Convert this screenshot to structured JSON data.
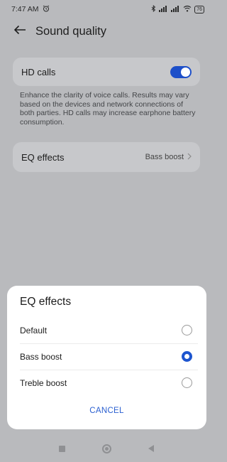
{
  "status_bar": {
    "time": "7:47 AM",
    "battery": "76"
  },
  "header": {
    "title": "Sound quality"
  },
  "hd_calls": {
    "label": "HD calls",
    "enabled": true,
    "description": "Enhance the clarity of voice calls. Results may vary based on the devices and network connections of both parties. HD calls may increase earphone battery consumption."
  },
  "eq_row": {
    "label": "EQ effects",
    "value": "Bass boost"
  },
  "dialog": {
    "title": "EQ effects",
    "options": [
      {
        "label": "Default",
        "selected": false
      },
      {
        "label": "Bass boost",
        "selected": true
      },
      {
        "label": "Treble boost",
        "selected": false
      }
    ],
    "cancel_label": "CANCEL"
  },
  "colors": {
    "accent": "#1d55cf",
    "scrim_background": "#b9babd",
    "card_background": "#c7c8cb"
  }
}
